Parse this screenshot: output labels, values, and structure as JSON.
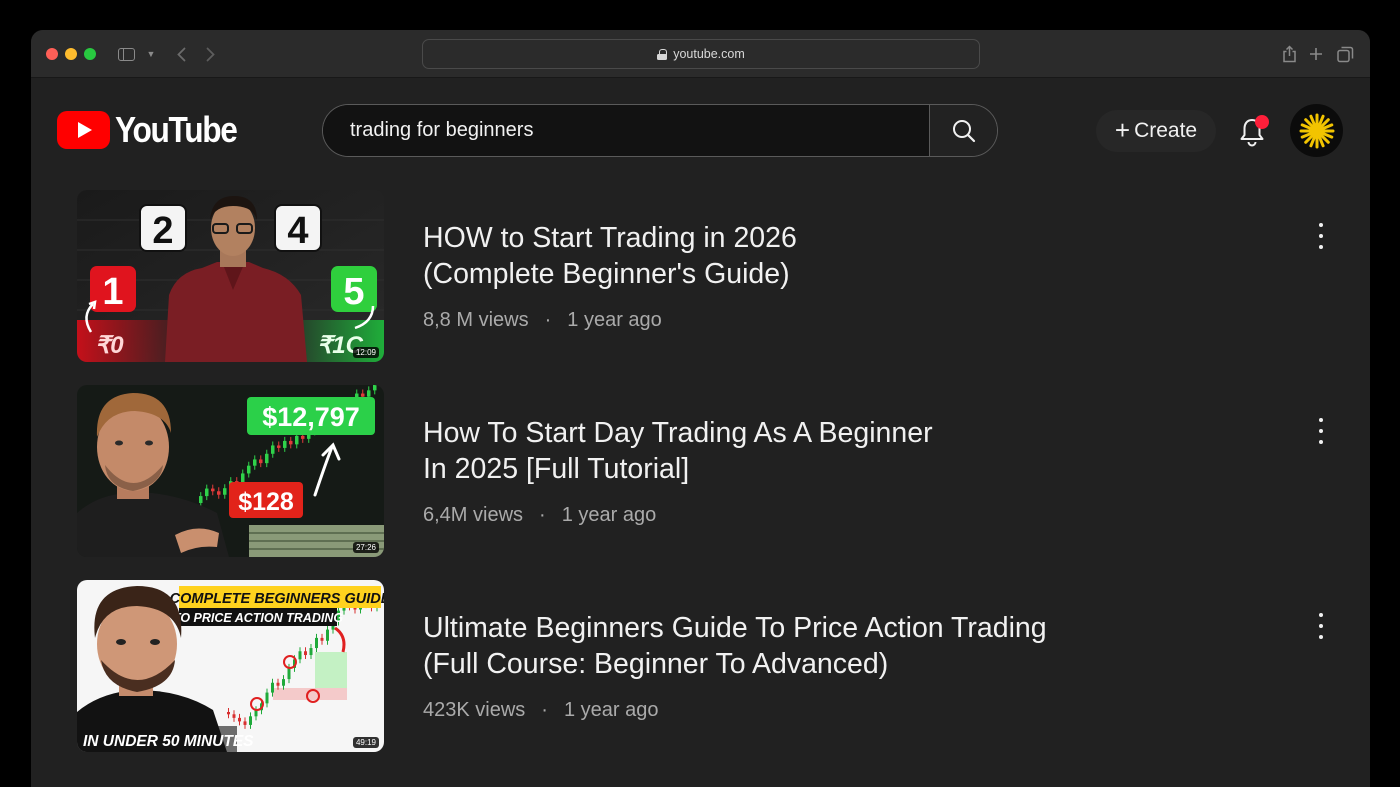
{
  "browser": {
    "url": "youtube.com"
  },
  "header": {
    "logo_text": "YouTube",
    "search_query": "trading for beginners",
    "create_label": "Create"
  },
  "results": [
    {
      "title_line1": "HOW to Start Trading in 2026",
      "title_line2": "(Complete Beginner's Guide)",
      "views": "8,8 M views",
      "age": "1 year ago",
      "duration": "12:09",
      "thumb_text": {
        "n1": "1",
        "n2": "2",
        "n4": "4",
        "n5": "5",
        "left_amount": "₹0",
        "right_amount": "₹1C"
      }
    },
    {
      "title_line1": "How To Start Day Trading As A Beginner",
      "title_line2": "In 2025 [Full Tutorial]",
      "views": "6,4M views",
      "age": "1 year ago",
      "duration": "27:26",
      "thumb_text": {
        "high": "$12,797",
        "low": "$128"
      }
    },
    {
      "title_line1": "Ultimate Beginners Guide To Price Action Trading",
      "title_line2": "(Full Course: Beginner To Advanced)",
      "views": "423K views",
      "age": "1 year ago",
      "duration": "49:19",
      "thumb_text": {
        "banner1": "COMPLETE BEGINNERS GUIDE",
        "banner2": "TO PRICE ACTION TRADING",
        "bottom": "IN UNDER 50 MINUTES"
      }
    }
  ],
  "colors": {
    "page_bg": "#212121",
    "brand_red": "#ff0000",
    "notification_dot": "#ff1f3a",
    "meta_text": "#aaaaaa"
  }
}
